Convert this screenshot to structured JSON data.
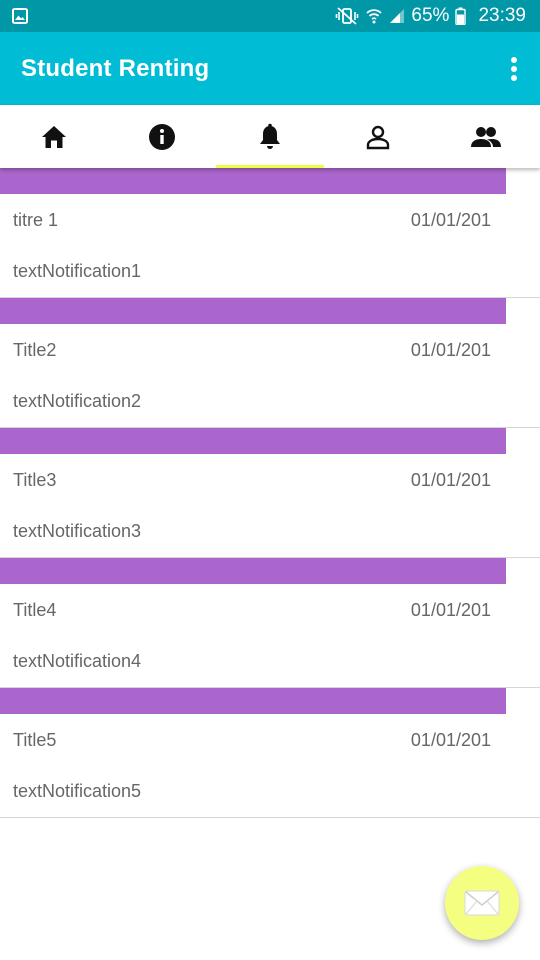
{
  "status_bar": {
    "battery": "65%",
    "time": "23:39",
    "icons": [
      "gallery-icon",
      "mute-vibrate-icon",
      "wifi-icon",
      "signal-icon",
      "battery-icon"
    ]
  },
  "app_bar": {
    "title": "Student Renting",
    "menu_icon": "overflow-menu-icon"
  },
  "tabs": [
    {
      "icon": "home-icon",
      "selected": false
    },
    {
      "icon": "info-icon",
      "selected": false
    },
    {
      "icon": "bell-icon",
      "selected": true
    },
    {
      "icon": "person-icon",
      "selected": false
    },
    {
      "icon": "group-icon",
      "selected": false
    }
  ],
  "notifications": [
    {
      "title": "titre 1",
      "date": "01/01/201",
      "text": "textNotification1"
    },
    {
      "title": "Title2",
      "date": "01/01/201",
      "text": "textNotification2"
    },
    {
      "title": "Title3",
      "date": "01/01/201",
      "text": "textNotification3"
    },
    {
      "title": "Title4",
      "date": "01/01/201",
      "text": "textNotification4"
    },
    {
      "title": "Title5",
      "date": "01/01/201",
      "text": "textNotification5"
    }
  ],
  "fab": {
    "icon": "envelope-icon"
  },
  "colors": {
    "status_bar": "#0097a7",
    "app_bar": "#00bcd4",
    "notification_band": "#aa66cc",
    "tab_indicator": "#eeff41",
    "fab": "#f4ff81"
  }
}
